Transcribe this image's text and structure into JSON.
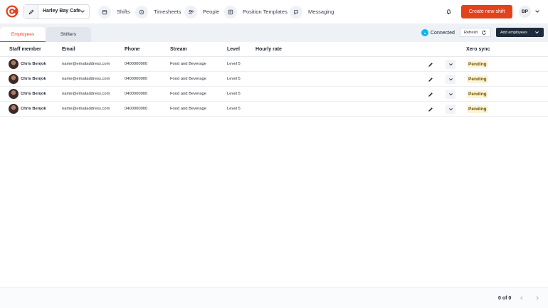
{
  "header": {
    "venue": "Harley Bay Cafe",
    "nav": [
      "Shifts",
      "Timesheets",
      "People",
      "Position Templates",
      "Messaging"
    ],
    "create_label": "Create new shift",
    "avatar_initials": "BP"
  },
  "tabs": [
    "Employees",
    "Shifters"
  ],
  "xero": {
    "status": "Connected",
    "refresh_label": "Refresh",
    "add_label": "Add employees"
  },
  "table": {
    "headers": [
      "Staff member",
      "Email",
      "Phone",
      "Stream",
      "Level",
      "Hourly rate",
      "Xero sync"
    ],
    "rows": [
      {
        "name": "Chris Benjok",
        "email": "name@emailaddress.com",
        "phone": "0400000000",
        "stream": "Food and Beverage",
        "level": "Level 5",
        "status": "Pending"
      },
      {
        "name": "Chris Benjok",
        "email": "name@emailaddress.com",
        "phone": "0400000000",
        "stream": "Food and Beverage",
        "level": "Level 5",
        "status": "Pending"
      },
      {
        "name": "Chris Benjok",
        "email": "name@emailaddress.com",
        "phone": "0400000000",
        "stream": "Food and Beverage",
        "level": "Level 5",
        "status": "Pending"
      },
      {
        "name": "Chris Benjok",
        "email": "name@emailaddress.com",
        "phone": "0400000000",
        "stream": "Food and Beverage",
        "level": "Level 5",
        "status": "Pending"
      }
    ]
  },
  "pagination": {
    "text": "0 of 0"
  },
  "colors": {
    "accent": "#e2421e",
    "dark_button": "#1d2b3a",
    "xero": "#13b5ea",
    "pending_bg": "#fdf5d7"
  }
}
